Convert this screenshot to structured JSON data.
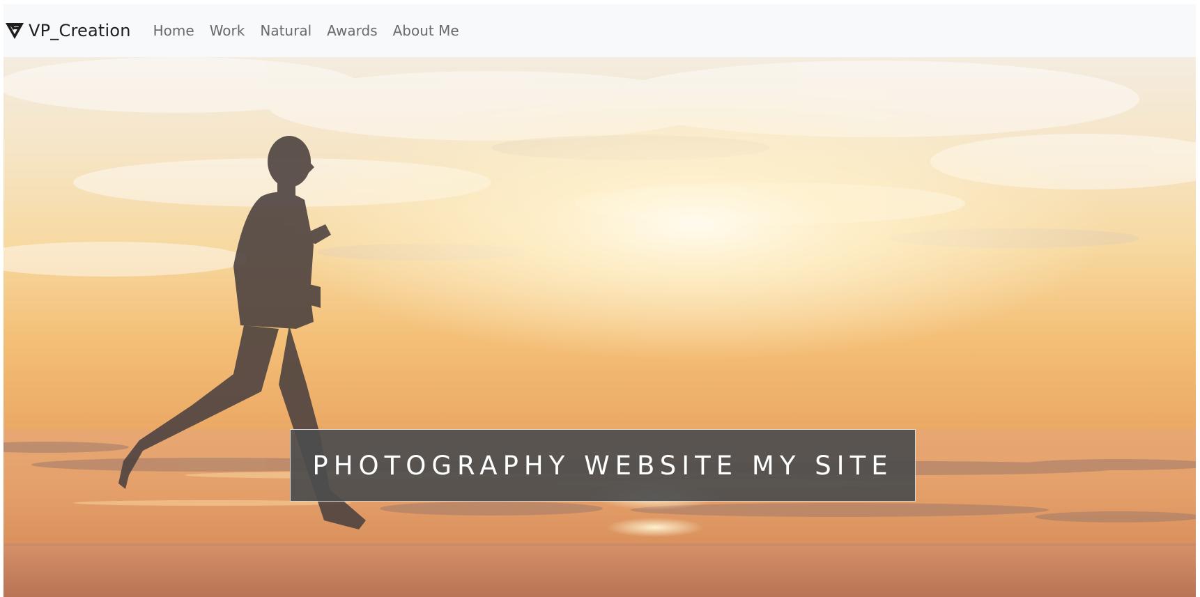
{
  "navbar": {
    "brand": {
      "label": "VP_Creation",
      "icon": "vp-logo-icon"
    },
    "links": [
      {
        "label": "Home"
      },
      {
        "label": "Work"
      },
      {
        "label": "Natural"
      },
      {
        "label": "Awards"
      },
      {
        "label": "About Me"
      }
    ]
  },
  "hero": {
    "image": "beach-runner-sunset-photo",
    "caption": "PHOTOGRAPHY WEBSITE MY SITE"
  },
  "colors": {
    "navbar_bg": "#f8f9fa",
    "nav_link": "#6a6a6a",
    "brand_text": "#1f1f1f",
    "caption_bg": "#4d4d4d",
    "caption_text": "#ffffff"
  }
}
